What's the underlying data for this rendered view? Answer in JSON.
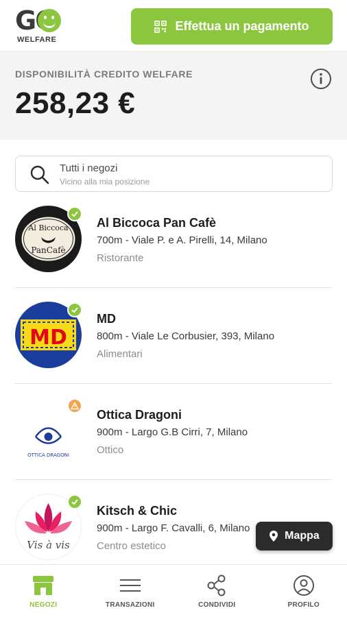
{
  "brand": {
    "logo_text": "GO",
    "logo_subtitle": "WELFARE",
    "accent_color": "#8cc63f"
  },
  "header": {
    "pay_button_label": "Effettua un pagamento",
    "pay_icon": "qr-code-icon"
  },
  "credit": {
    "label": "DISPONIBILITÀ CREDITO WELFARE",
    "amount": "258,23 €",
    "info_icon": "info-icon"
  },
  "search": {
    "primary_text": "Tutti i negozi",
    "secondary_text": "Vicino alla mia posizione"
  },
  "stores": [
    {
      "name": "Al Biccoca Pan Cafè",
      "address": "700m - Viale P. e A. Pirelli, 14, Milano",
      "category": "Ristorante",
      "status": "verified",
      "logo_text_top": "Al Biccoca",
      "logo_text_bottom": "PanCafè"
    },
    {
      "name": "MD",
      "address": "800m - Viale Le Corbusier, 393, Milano",
      "category": "Alimentari",
      "status": "verified",
      "logo_text": "MD"
    },
    {
      "name": "Ottica Dragoni",
      "address": "900m - Largo G.B Cirri, 7, Milano",
      "category": "Ottico",
      "status": "warning",
      "logo_text": "OTTICA DRAGONI"
    },
    {
      "name": "Kitsch & Chic",
      "address": "900m - Largo F. Cavalli, 6, Milano",
      "category": "Centro estetico",
      "status": "verified",
      "logo_text": "Vis à vis"
    }
  ],
  "map_button": {
    "label": "Mappa"
  },
  "nav": [
    {
      "label": "NEGOZI",
      "icon": "store-icon",
      "active": true
    },
    {
      "label": "TRANSAZIONI",
      "icon": "list-icon",
      "active": false
    },
    {
      "label": "CONDIVIDI",
      "icon": "share-icon",
      "active": false
    },
    {
      "label": "PROFILO",
      "icon": "profile-icon",
      "active": false
    }
  ]
}
